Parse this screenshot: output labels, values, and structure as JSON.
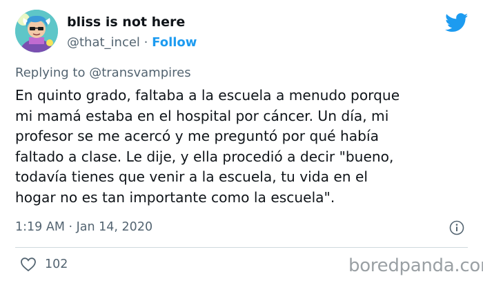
{
  "author": {
    "display_name": "bliss is not here",
    "handle": "@that_incel",
    "separator": "·",
    "follow_label": "Follow",
    "avatar_icon": "cartoon-avatar"
  },
  "brand": {
    "icon": "twitter-bird-icon",
    "color": "#1d9bf0"
  },
  "reply": {
    "text": "Replying to @transvampires"
  },
  "tweet": {
    "lines": [
      "En quinto grado, faltaba a la escuela a menudo porque",
      "mi mamá estaba en el hospital por cáncer. Un día, mi",
      "profesor se me acercó y me preguntó por qué había",
      "faltado a clase. Le dije, y ella procedió a decir \"bueno,",
      "todavía tienes que venir a la escuela, tu vida en el",
      "hogar no es tan importante como la escuela\"."
    ],
    "timestamp": "1:19 AM · Jan 14, 2020"
  },
  "actions": {
    "like_icon": "heart-icon",
    "like_count": "102",
    "info_icon": "info-icon"
  },
  "watermark": {
    "text": "boredpanda.com"
  }
}
